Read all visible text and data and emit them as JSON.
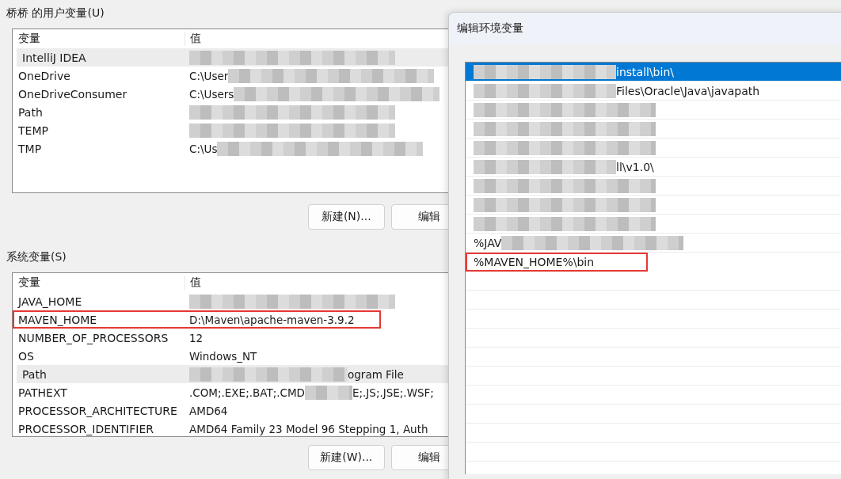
{
  "user_vars": {
    "title": "桥桥 的用户变量(U)",
    "columns": [
      "变量",
      "值"
    ],
    "rows": [
      {
        "name": "IntelliJ IDEA",
        "selected": true,
        "highlighted": false,
        "value": [
          {
            "kind": "mask"
          }
        ]
      },
      {
        "name": "OneDrive",
        "selected": false,
        "highlighted": false,
        "value": [
          {
            "kind": "text",
            "text": "C:\\User"
          },
          {
            "kind": "mask"
          }
        ]
      },
      {
        "name": "OneDriveConsumer",
        "selected": false,
        "highlighted": false,
        "value": [
          {
            "kind": "text",
            "text": "C:\\Users"
          },
          {
            "kind": "mask"
          }
        ]
      },
      {
        "name": "Path",
        "selected": false,
        "highlighted": false,
        "value": [
          {
            "kind": "mask"
          }
        ]
      },
      {
        "name": "TEMP",
        "selected": false,
        "highlighted": false,
        "value": [
          {
            "kind": "mask"
          }
        ]
      },
      {
        "name": "TMP",
        "selected": false,
        "highlighted": false,
        "value": [
          {
            "kind": "text",
            "text": "C:\\Us"
          },
          {
            "kind": "mask"
          }
        ]
      }
    ],
    "buttons": [
      "新建(N)...",
      "编辑"
    ]
  },
  "system_vars": {
    "title": "系统变量(S)",
    "columns": [
      "变量",
      "值"
    ],
    "rows": [
      {
        "name": "JAVA_HOME",
        "selected": false,
        "highlighted": false,
        "value": [
          {
            "kind": "mask"
          }
        ]
      },
      {
        "name": "MAVEN_HOME",
        "selected": false,
        "highlighted": true,
        "value": [
          {
            "kind": "text",
            "text": "D:\\Maven\\apache-maven-3.9.2"
          }
        ]
      },
      {
        "name": "NUMBER_OF_PROCESSORS",
        "selected": false,
        "highlighted": false,
        "value": [
          {
            "kind": "text",
            "text": "12"
          }
        ]
      },
      {
        "name": "OS",
        "selected": false,
        "highlighted": false,
        "value": [
          {
            "kind": "text",
            "text": "Windows_NT"
          }
        ]
      },
      {
        "name": "Path",
        "selected": true,
        "highlighted": false,
        "value": [
          {
            "kind": "mask"
          },
          {
            "kind": "text",
            "text": "ogram File"
          }
        ]
      },
      {
        "name": "PATHEXT",
        "selected": false,
        "highlighted": false,
        "value": [
          {
            "kind": "text",
            "text": ".COM;.EXE;.BAT;.CMD"
          },
          {
            "kind": "mask"
          },
          {
            "kind": "text",
            "text": "E;.JS;.JSE;.WSF;"
          }
        ]
      },
      {
        "name": "PROCESSOR_ARCHITECTURE",
        "selected": false,
        "highlighted": false,
        "value": [
          {
            "kind": "text",
            "text": "AMD64"
          }
        ]
      },
      {
        "name": "PROCESSOR_IDENTIFIER",
        "selected": false,
        "highlighted": false,
        "value": [
          {
            "kind": "text",
            "text": "AMD64 Family 23 Model 96 Stepping 1, Auth"
          }
        ]
      }
    ],
    "buttons": [
      "新建(W)...",
      "编辑"
    ]
  },
  "dialog": {
    "title": "编辑环境变量",
    "entries": [
      {
        "selected": true,
        "highlighted": false,
        "parts": [
          {
            "kind": "mask"
          },
          {
            "kind": "text",
            "text": "install\\bin\\"
          }
        ]
      },
      {
        "selected": false,
        "highlighted": false,
        "parts": [
          {
            "kind": "mask"
          },
          {
            "kind": "text",
            "text": "Files\\Oracle\\Java\\javapath"
          }
        ]
      },
      {
        "selected": false,
        "highlighted": false,
        "parts": [
          {
            "kind": "mask"
          }
        ]
      },
      {
        "selected": false,
        "highlighted": false,
        "parts": [
          {
            "kind": "mask"
          }
        ]
      },
      {
        "selected": false,
        "highlighted": false,
        "parts": [
          {
            "kind": "mask"
          }
        ]
      },
      {
        "selected": false,
        "highlighted": false,
        "parts": [
          {
            "kind": "mask"
          },
          {
            "kind": "text",
            "text": "ll\\v1.0\\"
          }
        ]
      },
      {
        "selected": false,
        "highlighted": false,
        "parts": [
          {
            "kind": "mask"
          }
        ]
      },
      {
        "selected": false,
        "highlighted": false,
        "parts": [
          {
            "kind": "mask"
          }
        ]
      },
      {
        "selected": false,
        "highlighted": false,
        "parts": [
          {
            "kind": "mask"
          }
        ]
      },
      {
        "selected": false,
        "highlighted": false,
        "parts": [
          {
            "kind": "text",
            "text": "%JAV"
          },
          {
            "kind": "mask"
          }
        ]
      },
      {
        "selected": false,
        "highlighted": true,
        "parts": [
          {
            "kind": "text",
            "text": "%MAVEN_HOME%\\bin"
          }
        ]
      }
    ]
  }
}
